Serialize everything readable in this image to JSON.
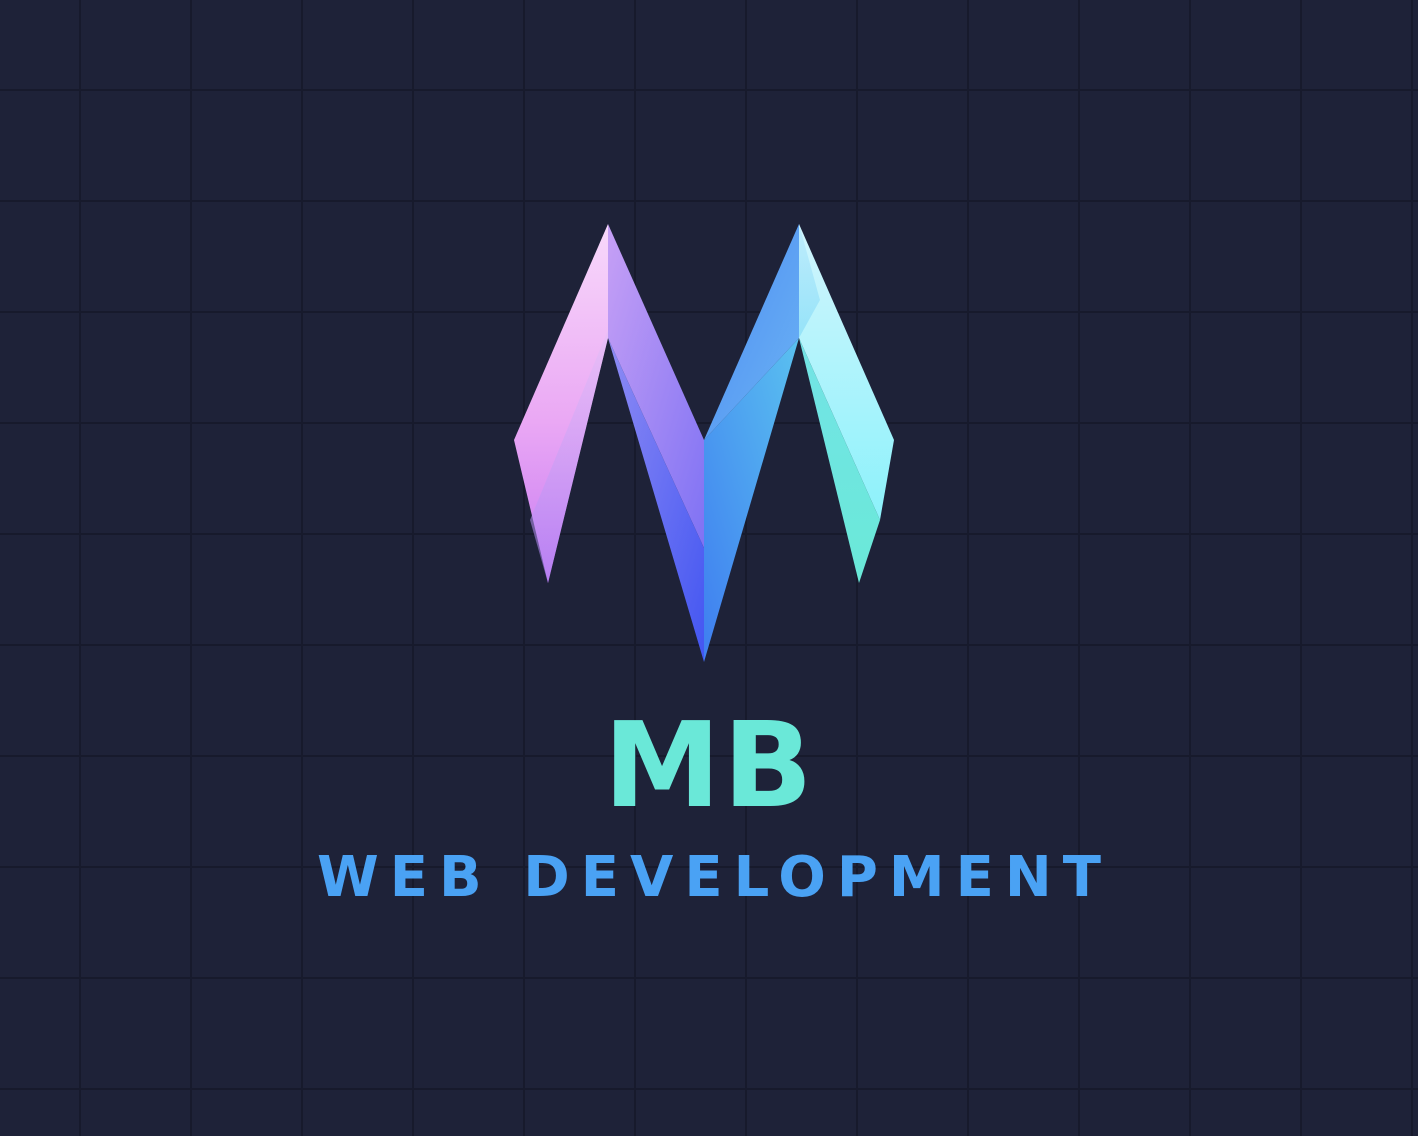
{
  "brand": {
    "name": "MB",
    "tagline": "WEB DEVELOPMENT"
  },
  "logo": {
    "icon": "stylized-m-logo-icon"
  },
  "colors": {
    "background": "#1e2238",
    "grid_line": "#171a2c",
    "name_text": "#6ae8d8",
    "tagline_text": "#4aa2f4",
    "gradient_pink": "#f2b6f6",
    "gradient_violet": "#9d7cf4",
    "gradient_blue": "#4c6bf5",
    "gradient_sky": "#4fa8f2",
    "gradient_cyan": "#8cf1fb",
    "gradient_teal": "#6ce9de"
  }
}
